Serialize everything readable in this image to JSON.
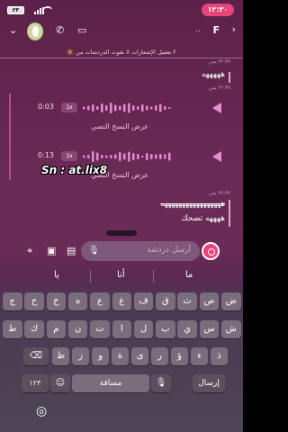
{
  "status_bar": {
    "time": "١٢:٣٠",
    "battery": "٢٣"
  },
  "header": {
    "name": "F",
    "name_suffix": "..",
    "avatar_icon": "bitmoji-avatar-icon"
  },
  "notice": "تفعيل الإشعارات لا تفوت الدردشات من F",
  "messages": {
    "ts1": "٢٢:٣٧ يس",
    "text1": "هههههه",
    "ts2": "٢٢:٣٧ يس",
    "voice1": {
      "duration": "0:03",
      "speed": "1x",
      "transcript": "عرض النسخ النصي"
    },
    "voice2": {
      "duration": "0:13",
      "speed": "1x",
      "transcript": "عرض النسخ النصي"
    },
    "ts3": "٢٢:٣٧ يس",
    "text2": "هههههههههههههههههه",
    "text3": "ههههه تضحك"
  },
  "watermark": "Sn : at.lix8",
  "input": {
    "placeholder": "أرسل دردشة"
  },
  "keyboard": {
    "suggestions": [
      "يا",
      "أنا",
      "ما"
    ],
    "row1": [
      "ض",
      "ص",
      "ث",
      "ق",
      "ف",
      "غ",
      "ع",
      "ه",
      "خ",
      "ح",
      "ج"
    ],
    "row2": [
      "ش",
      "س",
      "ي",
      "ب",
      "ل",
      "ا",
      "ت",
      "ن",
      "م",
      "ك",
      "ط"
    ],
    "row3": [
      "ذ",
      "ء",
      "ؤ",
      "ر",
      "ى",
      "ة",
      "و",
      "ز",
      "ظ"
    ],
    "numbers_key": "١٢٣",
    "space_key": "مسافة",
    "send_key": "إرسال"
  }
}
